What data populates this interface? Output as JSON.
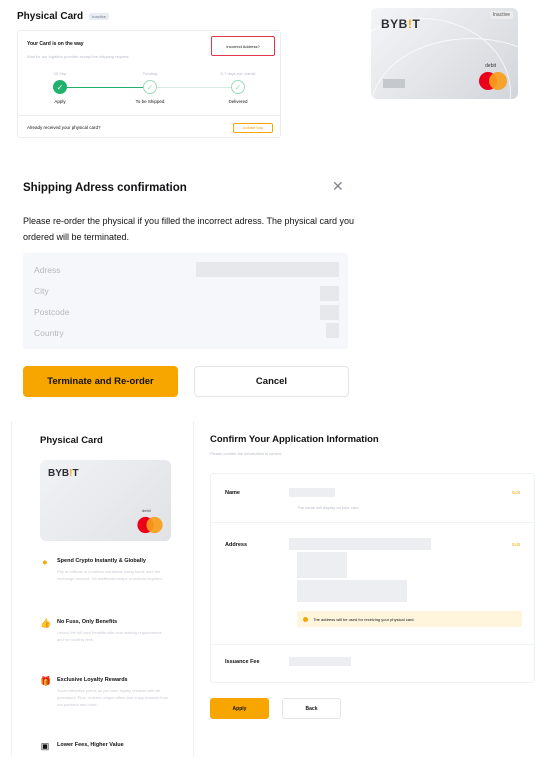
{
  "physical_card_status": {
    "title": "Physical Card",
    "badge": "Inactive",
    "status_heading": "Your Card is on the way",
    "status_sub": "Wait for our logistics provider accept the shipping request.",
    "incorrect_address_button": "Incorrect Address?",
    "steps": [
      {
        "date": "05 Sep",
        "label": "Apply",
        "done": true
      },
      {
        "date": "Pending",
        "label": "To be Shipped",
        "done": false
      },
      {
        "date": "5-7 days est. transit",
        "label": "Delivered",
        "done": false
      }
    ],
    "footer_text": "Already received your physical card?",
    "activate_button": "Activate Now",
    "card": {
      "brand_prefix": "BYB",
      "brand_suffix": "T",
      "brand_accent": "!",
      "state": "Inactive",
      "type": "debit"
    }
  },
  "shipping_dialog": {
    "title": "Shipping Adress confirmation",
    "close_icon": "close-icon",
    "message": "Please re-order the physical if you filled the incorrect adress. The physical card you ordered will be terminated.",
    "fields": [
      "Adress",
      "City",
      "Postcode",
      "Country"
    ],
    "terminate_button": "Terminate and Re-order",
    "cancel_button": "Cancel"
  },
  "application": {
    "side_title": "Physical Card",
    "card": {
      "brand_prefix": "BYB",
      "brand_accent": "!",
      "brand_suffix": "T",
      "type": "debit"
    },
    "benefits": [
      {
        "icon": "coin-icon",
        "glyph": "●",
        "title": "Spend Crypto Instantly & Globally",
        "desc": "Pay at millions of locations worldwide using funds from the exchange account. No additional swaps or actions required."
      },
      {
        "icon": "thumbs-up-icon",
        "glyph": "👍",
        "title": "No Fuss, Only Benefits",
        "desc": "Unlock the full card benefits with zero staking requirements and no monthly fees."
      },
      {
        "icon": "gift-icon",
        "glyph": "🎁",
        "title": "Exclusive Loyalty Rewards",
        "desc": "Score attractive points as you earn loyalty rewards with all purchases. Plus, redeem unique offers and enjoy rewards from our partners and more."
      },
      {
        "icon": "document-icon",
        "glyph": "▣",
        "title": "Lower Fees, Higher Value",
        "desc": ""
      }
    ],
    "main_title": "Confirm Your Application Information",
    "main_sub": "Please confirm the information is correct.",
    "form": {
      "name_label": "Name",
      "name_hint": "The name will display on your card.",
      "address_label": "Address",
      "address_warning": "The address will be used for receiving your physical card.",
      "fee_label": "Issuance Fee",
      "edit_label": "Edit"
    },
    "apply_button": "Apply",
    "back_button": "Back"
  },
  "colors": {
    "accent": "#f7a600",
    "success": "#20b26c",
    "danger": "#e5354b"
  }
}
